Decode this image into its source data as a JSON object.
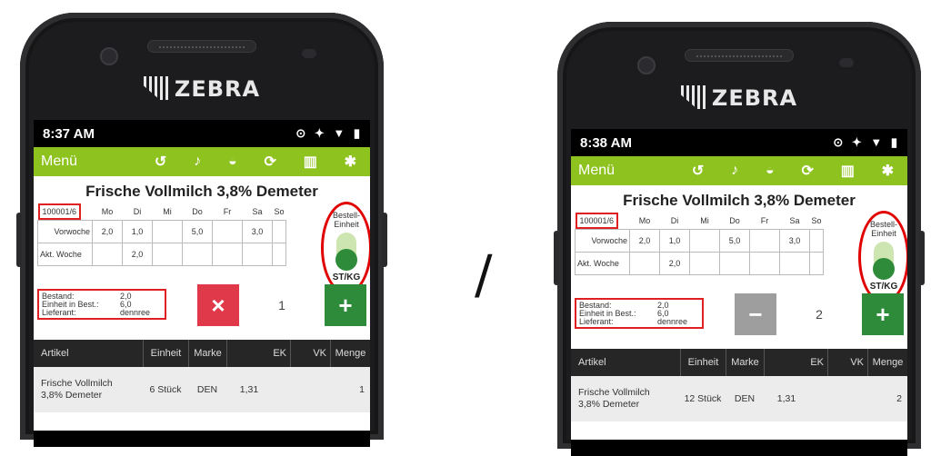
{
  "brand": "ZEBRA",
  "separator": "/",
  "colors": {
    "accent_green": "#8dc21f",
    "cancel_red": "#e0394a",
    "plus_green": "#2e8b3a",
    "minus_grey": "#9e9e9e",
    "highlight_red": "#e00000"
  },
  "app": {
    "menu_label": "Menü",
    "toolbar_icons": [
      "history-icon",
      "bell-icon",
      "inbox-icon",
      "refresh-icon",
      "trash-icon",
      "gear-icon"
    ],
    "product_title": "Frische Vollmilch 3,8% Demeter",
    "article_id": "100001/6",
    "days": [
      "Mo",
      "Di",
      "Mi",
      "Do",
      "Fr",
      "Sa",
      "So"
    ],
    "row_labels": {
      "prev_week": "Vorwoche",
      "curr_week": "Akt. Woche"
    },
    "prev_week_values": [
      "2,0",
      "1,0",
      "",
      "5,0",
      "",
      "3,0",
      ""
    ],
    "curr_week_values": [
      "",
      "2,0",
      "",
      "",
      "",
      "",
      ""
    ],
    "order_unit": {
      "label_line1": "Bestell-",
      "label_line2": "Einheit",
      "toggle_label": "ST/KG"
    },
    "info": {
      "stock_label": "Bestand:",
      "stock_value": "2,0",
      "unit_label": "Einheit in Best.:",
      "unit_value": "6,0",
      "supplier_label": "Lieferant:",
      "supplier_value": "dennree"
    },
    "table_headers": [
      "Artikel",
      "Einheit",
      "Marke",
      "EK",
      "VK",
      "Menge"
    ]
  },
  "screens": [
    {
      "time": "8:37 AM",
      "left_button": "×",
      "quantity": "1",
      "right_button": "+",
      "row": {
        "artikel_line1": "Frische Vollmilch",
        "artikel_line2": "3,8% Demeter",
        "einheit": "6 Stück",
        "marke": "DEN",
        "ek": "1,31",
        "vk": "",
        "menge": "1"
      }
    },
    {
      "time": "8:38 AM",
      "left_button": "−",
      "quantity": "2",
      "right_button": "+",
      "row": {
        "artikel_line1": "Frische Vollmilch",
        "artikel_line2": "3,8% Demeter",
        "einheit": "12 Stück",
        "marke": "DEN",
        "ek": "1,31",
        "vk": "",
        "menge": "2"
      }
    }
  ]
}
